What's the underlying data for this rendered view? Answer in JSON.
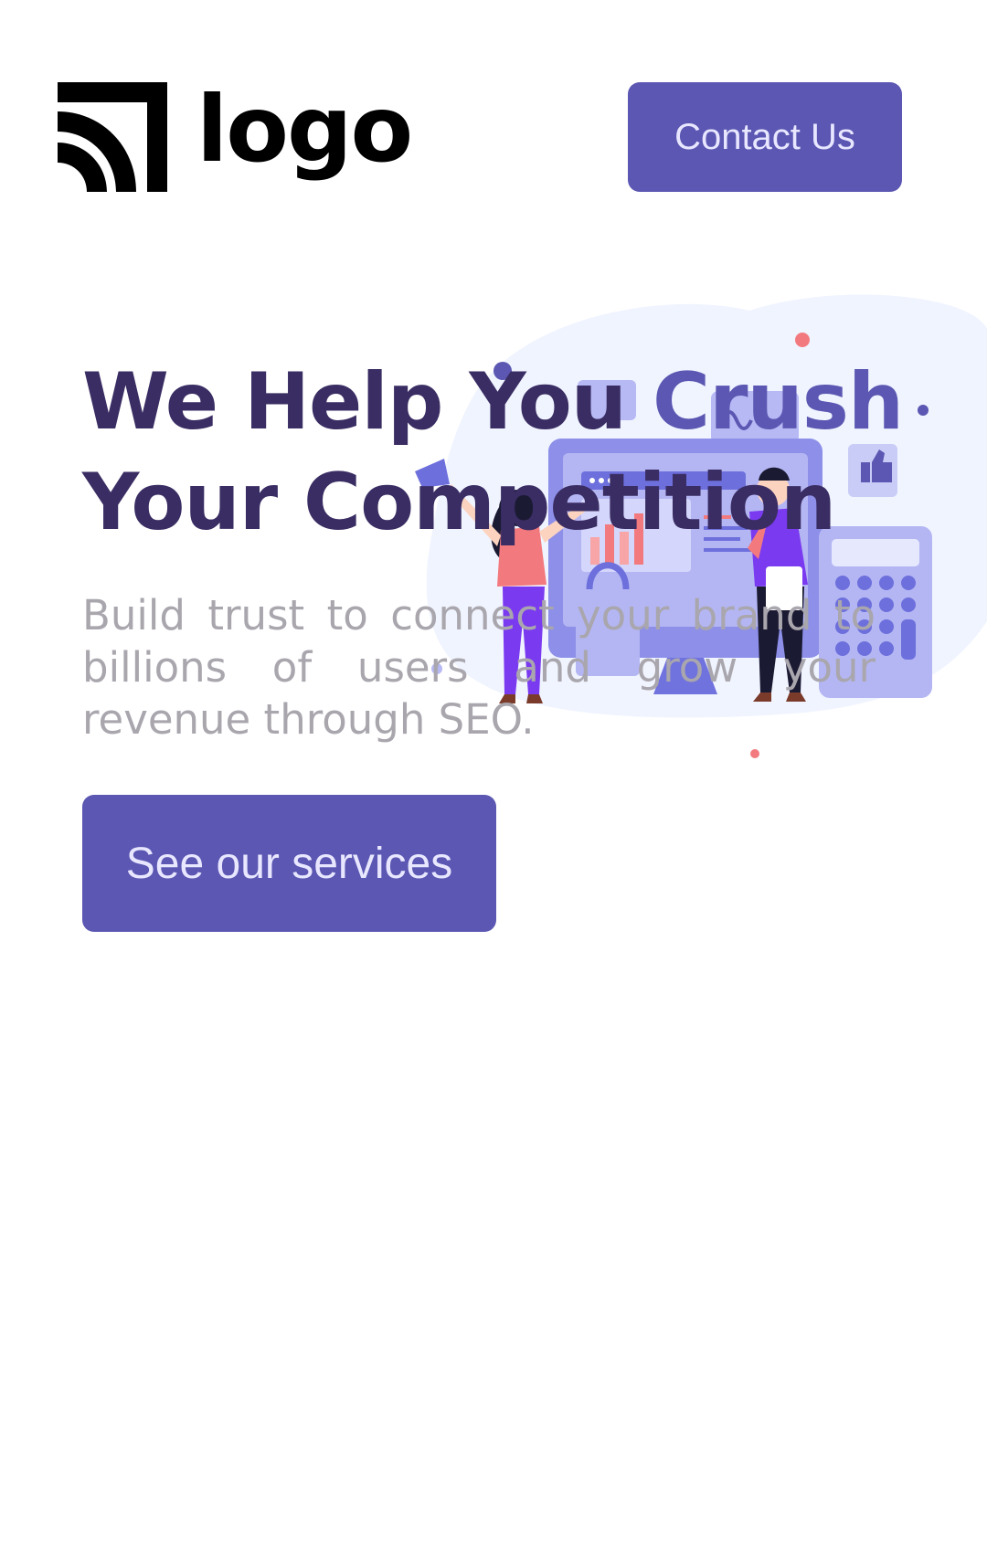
{
  "header": {
    "logo_text": "logo",
    "contact_label": "Contact Us"
  },
  "hero": {
    "title_line1_a": "We Help You ",
    "title_line1_b": "Crush",
    "title_line2": "Your Competition",
    "subtitle": "Build trust to connect your brand to billions of users and grow your revenue through SEO.",
    "cta_label": "See our services"
  },
  "colors": {
    "brand": "#5b57b2",
    "heading": "#3a2d63",
    "body_text": "#a9a6ad",
    "illustration_bg": "#f0f4ff",
    "accent_pink": "#f27a7e"
  }
}
